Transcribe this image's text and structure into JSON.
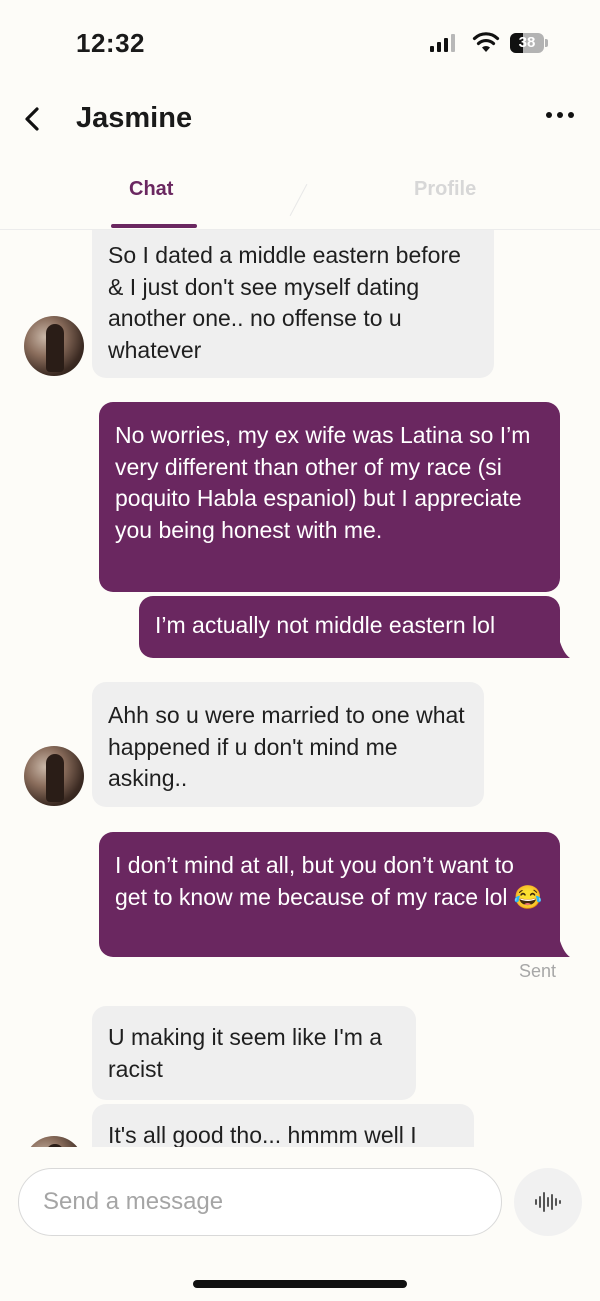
{
  "status_bar": {
    "time": "12:32",
    "battery": "38",
    "icons": [
      "signal-icon",
      "wifi-icon",
      "battery-icon"
    ]
  },
  "header": {
    "contact_name": "Jasmine",
    "back_icon": "chevron-left-icon",
    "more_icon": "more-horizontal-icon"
  },
  "tabs": [
    {
      "label": "Chat",
      "active": true
    },
    {
      "label": "Profile",
      "active": false
    }
  ],
  "messages": [
    {
      "from": "them",
      "text": "So I dated a middle eastern before & I just don't see myself dating another one.. no offense to u whatever"
    },
    {
      "from": "me",
      "text": "No worries, my ex wife was Latina so I’m very different than other of my race (si poquito Habla espaniol) but I appreciate you being honest with me."
    },
    {
      "from": "me",
      "text": "I’m actually not middle eastern lol"
    },
    {
      "from": "them",
      "text": "Ahh so u were married to one what happened if u don't mind me asking.."
    },
    {
      "from": "me",
      "text": "I don’t mind at all, but you don’t want to get to know me because of my race lol 😂"
    },
    {
      "from": "them",
      "text": "U making it seem like I'm a racist"
    },
    {
      "from": "them",
      "text": "It's all good tho... hmmm well I"
    }
  ],
  "sent_status": "Sent",
  "composer": {
    "placeholder": "Send a message",
    "voice_icon": "audio-waveform-icon"
  },
  "colors": {
    "accent": "#6a2760",
    "received_bubble": "#efefef",
    "background": "#fdfcf8"
  }
}
